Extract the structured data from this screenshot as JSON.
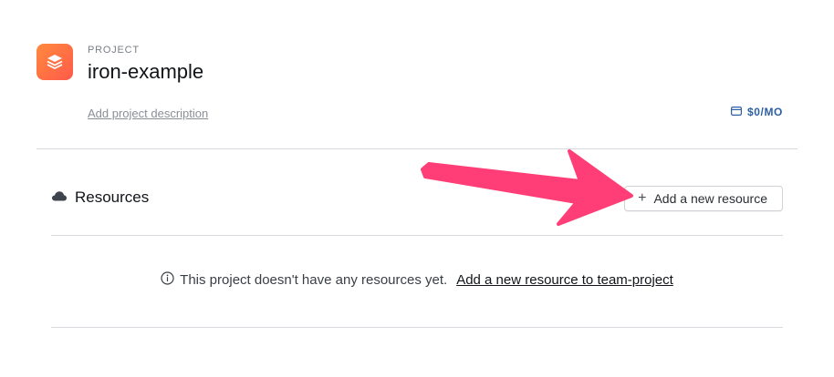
{
  "project": {
    "eyebrow": "PROJECT",
    "name": "iron-example",
    "add_description": "Add project description",
    "cost": "$0/MO"
  },
  "resources": {
    "title": "Resources",
    "add_button_label": "Add a new resource",
    "empty_message": "This project doesn't have any resources yet.",
    "empty_link": "Add a new resource to team-project"
  },
  "colors": {
    "icon_gradient_start": "#ff8a3d",
    "icon_gradient_end": "#ff5a4a",
    "arrow": "#ff3d77",
    "cost_text": "#2d5fa3"
  },
  "icons": {
    "project": "layers-icon",
    "cost": "credit-card-icon",
    "resources": "cloud-icon",
    "add": "plus-icon",
    "info": "info-icon",
    "annotation": "arrow-annotation"
  }
}
